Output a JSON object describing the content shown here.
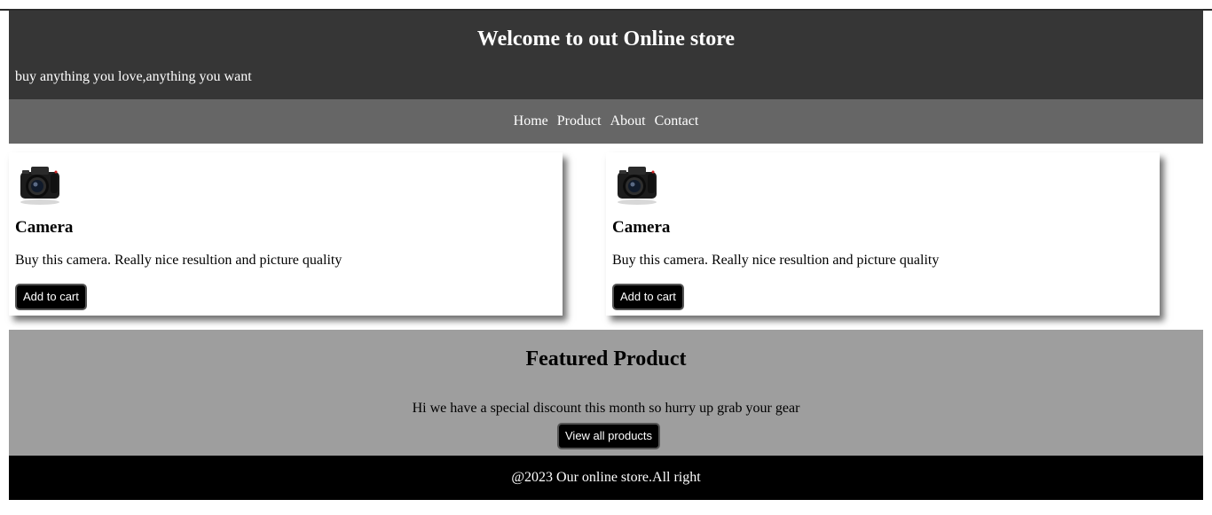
{
  "header": {
    "title": "Welcome to out Online store",
    "tagline": "buy anything you love,anything you want"
  },
  "nav": {
    "items": [
      {
        "label": "Home"
      },
      {
        "label": "Product"
      },
      {
        "label": "About"
      },
      {
        "label": "Contact"
      }
    ]
  },
  "products": [
    {
      "image_icon": "camera-icon",
      "title": "Camera",
      "description": "Buy this camera. Really nice resultion and picture quality",
      "button_label": "Add to cart"
    },
    {
      "image_icon": "camera-icon",
      "title": "Camera",
      "description": "Buy this camera. Really nice resultion and picture quality",
      "button_label": "Add to cart"
    }
  ],
  "featured": {
    "heading": "Featured Product",
    "text": "Hi we have a special discount this month so hurry up grab your gear",
    "button_label": "View all products"
  },
  "footer": {
    "text": "@2023 Our online store.All right"
  },
  "colors": {
    "header_bg": "#363636",
    "nav_bg": "#666666",
    "featured_bg": "#9e9e9e",
    "footer_bg": "#000000",
    "button_bg": "#000000"
  }
}
